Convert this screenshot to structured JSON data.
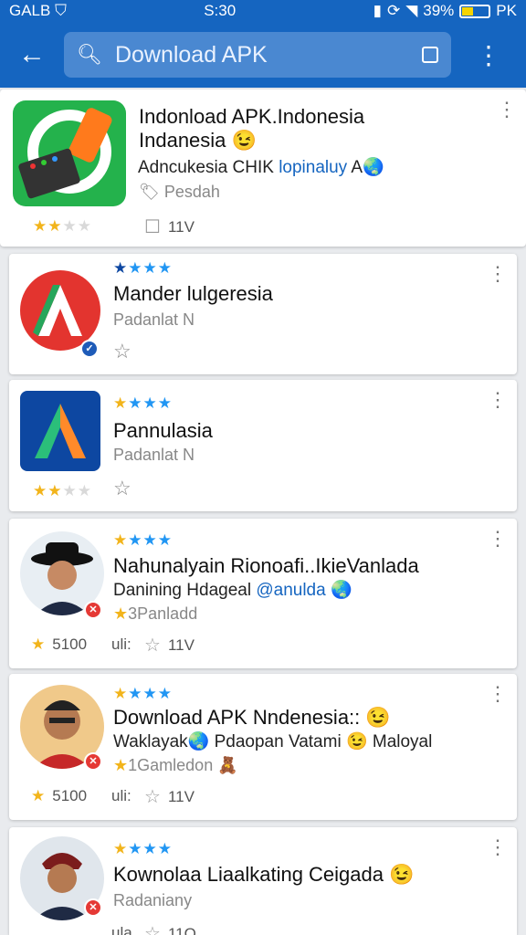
{
  "status": {
    "carrier": "GALB",
    "time": "S:30",
    "battery": "39%",
    "extra": "PK",
    "battery_level": 0.39
  },
  "appbar": {
    "search_placeholder": "Download APK"
  },
  "cards": [
    {
      "title_line1": "Indonload APK.Indonesia",
      "title_line2": "Indanesia 😉",
      "subtitle": "Adncukesia CHIK",
      "subtitle_link": "lopinaluy",
      "subtitle_tail": "A🌏",
      "meta": "Pesdah",
      "comments": "11V",
      "rating": 2
    },
    {
      "title": "Mander lulgeresia",
      "meta": "Padanlat N",
      "rating": 1
    },
    {
      "title": "Pannulasia",
      "meta": "Padanlat N",
      "rating": 1
    },
    {
      "title_line1": "Nahunalyain Rionoafi..IkieVanlada",
      "title_line2": "Danining Hdageal",
      "handle": "@anulda 🌏",
      "meta": "3Panladd",
      "downloads": "5100",
      "comments": "11V",
      "ui_label": "uli:",
      "rating": 2
    },
    {
      "title_line1": "Download APK Nndenesia:: 😉",
      "subtitle": "Waklayak🌏 Pdaopan Vatami 😉 Maloyal",
      "meta": "1Gamledon 🧸",
      "downloads": "5100",
      "comments": "11V",
      "ui_label": "uli:",
      "rating": 2
    },
    {
      "title_line1": "Kownolaa Liaalkating Ceigada 😉",
      "meta": "Radaniany",
      "comments": "11O",
      "ui_label": "ula",
      "rating": 2
    }
  ]
}
